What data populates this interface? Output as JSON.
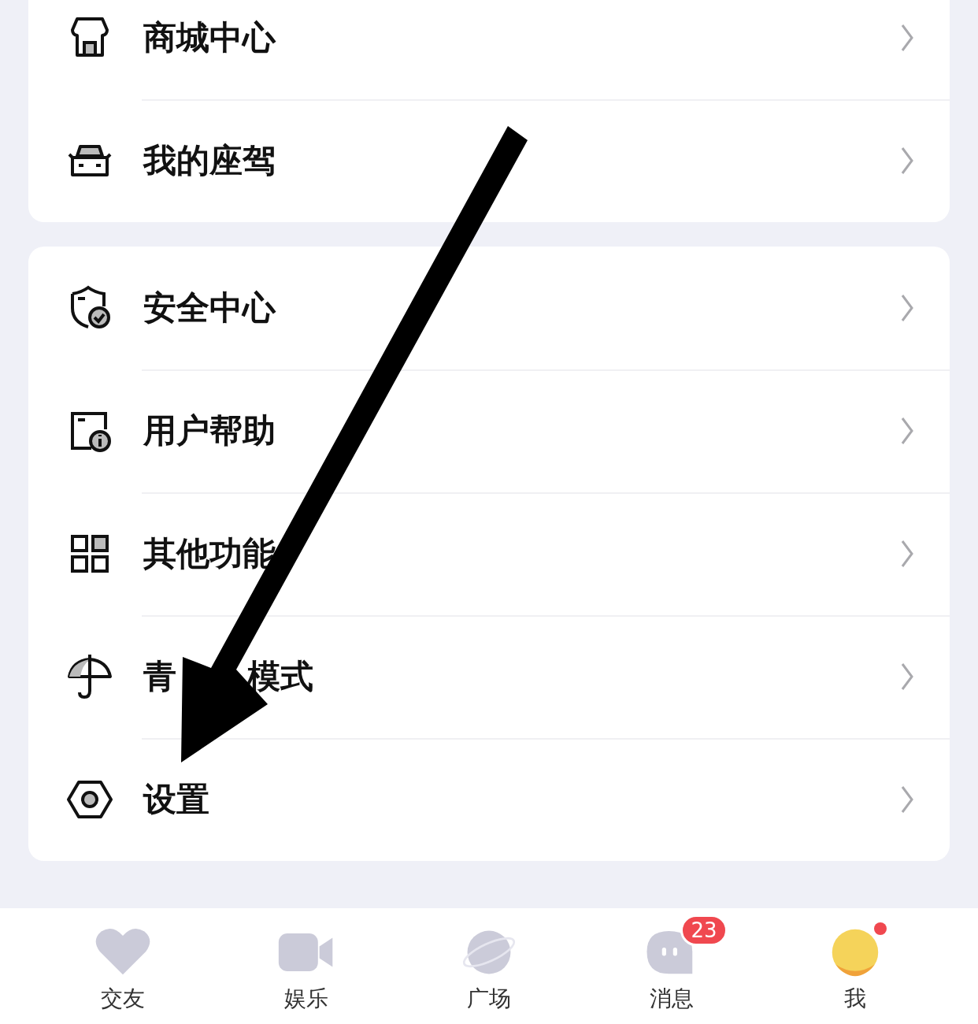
{
  "sections": [
    {
      "items": [
        {
          "kind": "store",
          "label": "商城中心"
        },
        {
          "kind": "car",
          "label": "我的座驾"
        }
      ]
    },
    {
      "items": [
        {
          "kind": "shield",
          "label": "安全中心"
        },
        {
          "kind": "help",
          "label": "用户帮助"
        },
        {
          "kind": "grid",
          "label": "其他功能"
        },
        {
          "kind": "umbrella",
          "label_parts": [
            "青",
            "模式"
          ]
        },
        {
          "kind": "settings",
          "label": "设置"
        }
      ]
    }
  ],
  "tabs": [
    {
      "kind": "heart",
      "label": "交友",
      "selected": false
    },
    {
      "kind": "video",
      "label": "娱乐",
      "selected": false
    },
    {
      "kind": "planet",
      "label": "广场",
      "selected": false
    },
    {
      "kind": "chat",
      "label": "消息",
      "selected": false,
      "badge": "23"
    },
    {
      "kind": "avatar",
      "label": "我",
      "selected": true,
      "dot": true
    }
  ]
}
